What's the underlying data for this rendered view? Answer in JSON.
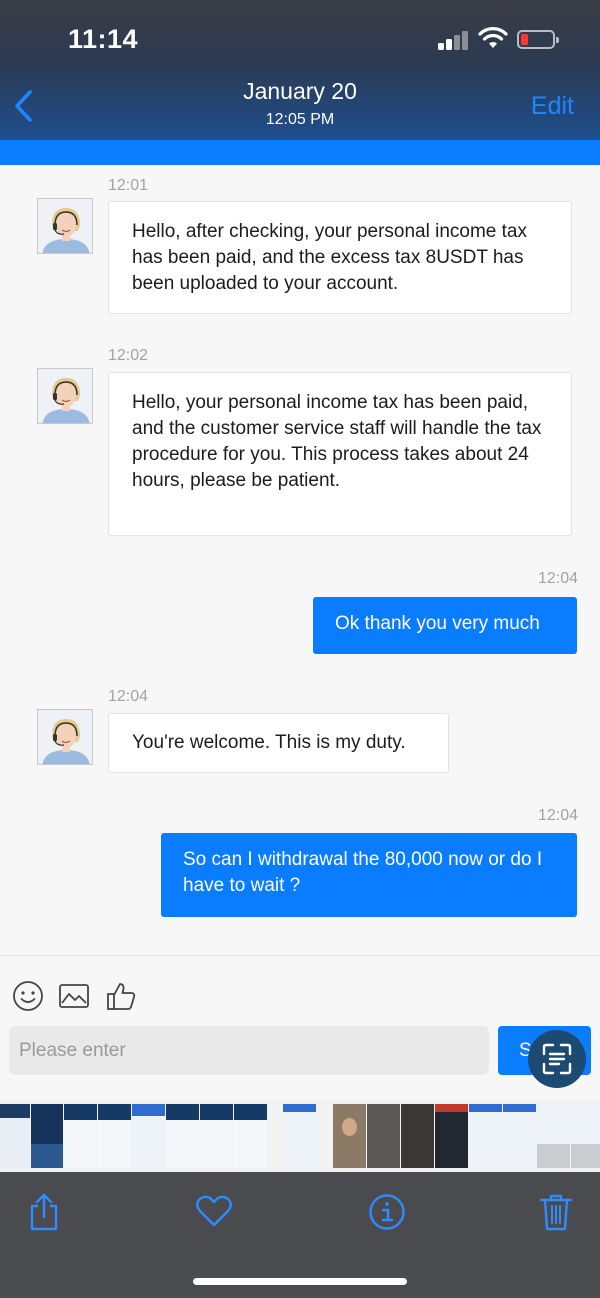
{
  "status_bar": {
    "time": "11:14"
  },
  "header": {
    "title": "January 20",
    "subtitle": "12:05 PM",
    "edit_label": "Edit"
  },
  "messages": [
    {
      "direction": "incoming",
      "time": "12:01",
      "text": "Hello, after checking, your personal income tax has been paid, and the excess tax 8USDT has been uploaded to your account."
    },
    {
      "direction": "incoming",
      "time": "12:02",
      "text": "Hello, your personal income tax has been paid, and the customer service staff will handle the tax procedure for you. This process takes about 24 hours, please be patient."
    },
    {
      "direction": "outgoing",
      "time": "12:04",
      "text": "Ok thank you very much"
    },
    {
      "direction": "incoming",
      "time": "12:04",
      "text": "You're welcome. This is my duty."
    },
    {
      "direction": "outgoing",
      "time": "12:04",
      "text": "So can I withdrawal the 80,000 now or do I have to wait ?"
    }
  ],
  "composer": {
    "placeholder": "Please enter",
    "send_label": "Send",
    "icons": [
      "emoji-icon",
      "image-icon",
      "thumbs-up-icon"
    ]
  },
  "bottom_bar": {
    "icons": [
      "share-icon",
      "heart-icon",
      "info-icon",
      "trash-icon"
    ]
  },
  "colors": {
    "accent": "#0a7cff",
    "header_top": "#3a3d44",
    "header_bottom": "#1e4f8e",
    "battery_low": "#ff3b30"
  }
}
